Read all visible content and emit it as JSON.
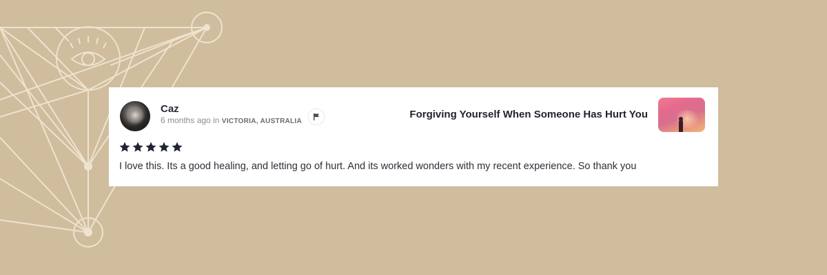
{
  "review": {
    "reviewer_name": "Caz",
    "time_ago": "6 months ago",
    "in_word": "in",
    "location": "VICTORIA, AUSTRALIA",
    "rating": 5,
    "rating_max": 5,
    "text": "I love this. Its a good healing, and letting go of hurt. And its worked wonders with my recent experience. So thank you"
  },
  "meditation": {
    "title": "Forgiving Yourself When Someone Has Hurt You"
  },
  "icons": {
    "flag": "flag-icon",
    "star": "star-icon",
    "background": "sacred-geometry-eye"
  },
  "colors": {
    "background": "#cfbd9e",
    "card": "#ffffff",
    "star": "#1f2433",
    "line_art": "#efe3cf"
  }
}
